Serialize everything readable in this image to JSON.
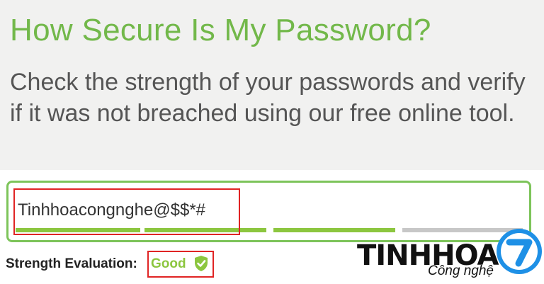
{
  "hero": {
    "title": "How Secure Is My Password?",
    "subtitle": "Check the strength of your passwords and verify if it was not breached using our free online tool."
  },
  "password_input": {
    "value": "Tinhhoacongnghe@$$*#",
    "strength_segments_filled": 3,
    "strength_segments_total": 4
  },
  "strength": {
    "label": "Strength Evaluation:",
    "value": "Good",
    "icon": "shield-check-icon"
  },
  "watermark": {
    "brand": "TINHHOA",
    "tagline": "Công nghệ",
    "badge": "7"
  },
  "colors": {
    "accent_green": "#8cc63f",
    "title_green": "#72b84a",
    "highlight_red": "#e02424",
    "logo_blue": "#1e90e6"
  }
}
